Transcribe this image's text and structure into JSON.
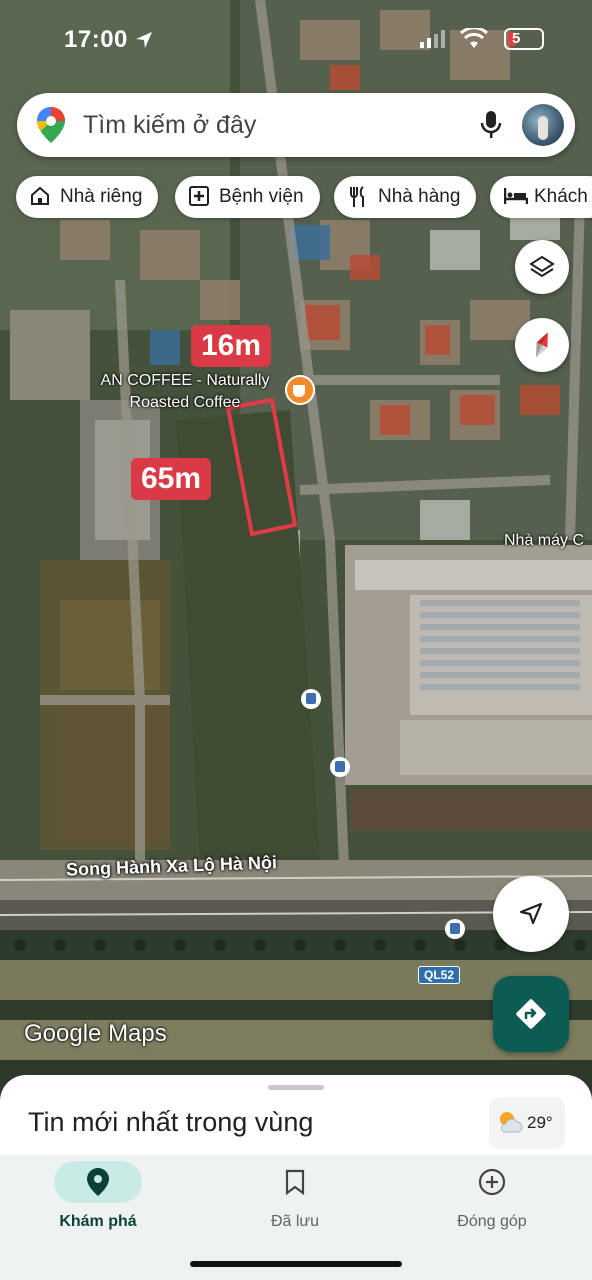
{
  "status_bar": {
    "time": "17:00",
    "battery_level": "5"
  },
  "search": {
    "placeholder": "Tìm kiếm ở đây"
  },
  "chips": [
    {
      "label": "Nhà riêng",
      "icon": "home-icon"
    },
    {
      "label": "Bệnh viện",
      "icon": "hospital-icon"
    },
    {
      "label": "Nhà hàng",
      "icon": "restaurant-icon"
    },
    {
      "label": "Khách",
      "icon": "hotel-icon"
    }
  ],
  "map": {
    "poi_label": "AN COFFEE - Naturally Roasted Coffee",
    "factory_label": "Nhà máy C",
    "road_label": "Song Hành Xa Lộ Hà Nội",
    "route_badge": "QL52",
    "width_annotation": "16m",
    "length_annotation": "65m",
    "attribution": {
      "brand": "Google",
      "product": "Maps"
    },
    "highlight_color": "#e23b46"
  },
  "bottom_sheet": {
    "title": "Tin mới nhất trong vùng",
    "temperature": "29°"
  },
  "bottom_nav": [
    {
      "label": "Khám phá",
      "icon": "explore-pin-icon",
      "active": true
    },
    {
      "label": "Đã lưu",
      "icon": "bookmark-icon",
      "active": false
    },
    {
      "label": "Đóng góp",
      "icon": "add-circle-icon",
      "active": false
    }
  ],
  "colors": {
    "accent": "#0d5c54",
    "active_nav_bg": "#c8ebe6",
    "measure_red": "#d93a45"
  }
}
